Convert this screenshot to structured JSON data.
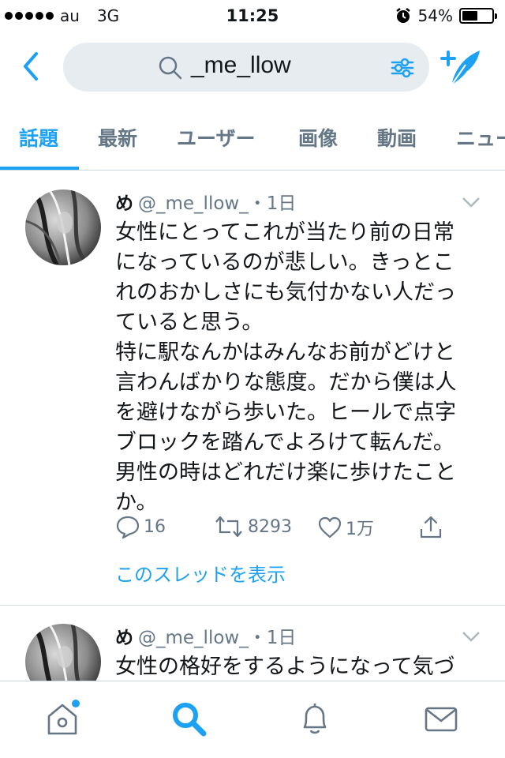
{
  "status_bar": {
    "carrier": "au",
    "network": "3G",
    "time": "11:25",
    "battery": "54%",
    "battery_level": 0.54
  },
  "header": {
    "search_query": "_me_llow",
    "back_icon": "chevron-left-icon",
    "filter_icon": "sliders-icon",
    "compose_icon": "add-feather-icon"
  },
  "tabs": [
    "話題",
    "最新",
    "ユーザー",
    "画像",
    "動画",
    "ニュー"
  ],
  "active_tab": "話題",
  "tweets": [
    {
      "name": "め",
      "handle_time": "@_me_llow_・1日",
      "lines": [
        "女性にとってこれが当たり前の日常",
        "になっているのが悲しい。きっとこ",
        "れのおかしさにも気付かない人だっ",
        "ていると思う。",
        "特に駅なんかはみんなお前がどけと",
        "言わんばかりな態度。だから僕は人",
        "を避けながら歩いた。ヒールで点字",
        "ブロックを踏んでよろけて転んだ。",
        "男性の時はどれだけ楽に歩けたこと",
        "か。"
      ],
      "replies": "16",
      "retweets": "8293",
      "likes": "1万",
      "thread_link": "このスレッドを表示"
    },
    {
      "name": "め",
      "handle_time": "@_me_llow_・1日",
      "lines": [
        "女性の格好をするようになって気づ"
      ]
    }
  ],
  "bottom_nav": {
    "items": [
      "home-icon",
      "search-icon",
      "notifications-icon",
      "messages-icon"
    ],
    "active": "search-icon"
  },
  "colors": {
    "accent": "#1da1f2",
    "text": "#14171a",
    "muted": "#657786",
    "search_bg": "#e6ecf0"
  }
}
